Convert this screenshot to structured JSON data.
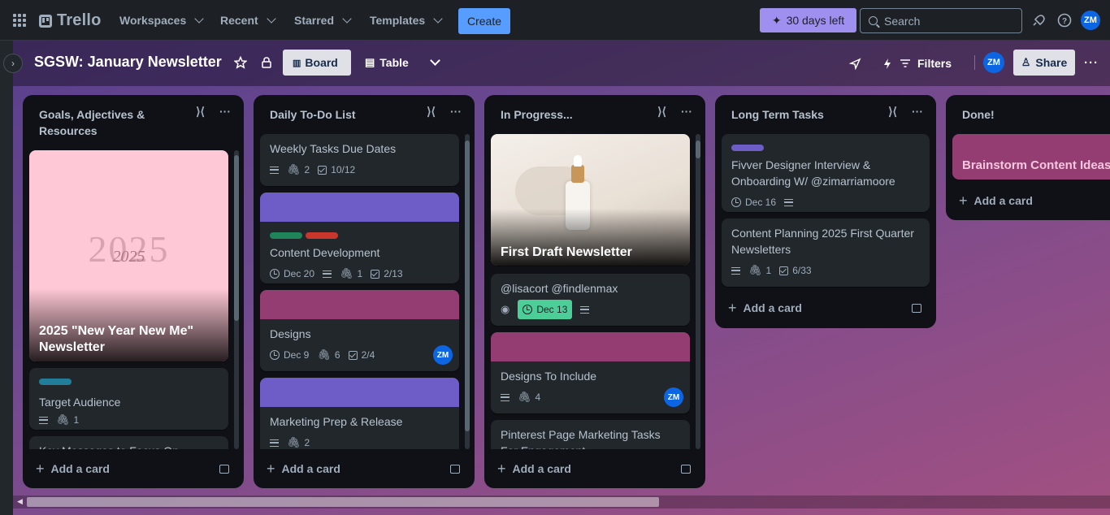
{
  "nav": {
    "logo": "Trello",
    "menus": [
      "Workspaces",
      "Recent",
      "Starred",
      "Templates"
    ],
    "create": "Create",
    "trial": "30 days left",
    "search_placeholder": "Search",
    "avatar": "ZM"
  },
  "board": {
    "title": "SGSW: January Newsletter",
    "views": {
      "board": "Board",
      "table": "Table"
    },
    "filters": "Filters",
    "member": "ZM",
    "share": "Share"
  },
  "lists": [
    {
      "title": "Goals, Adjectives & Resources",
      "add_card": "Add a card",
      "cards": [
        {
          "title": "2025 \"New Year New Me\" Newsletter",
          "cover_art_text": "2025"
        },
        {
          "title": "Target Audience",
          "label_color": "#227d9b",
          "attachments": "1"
        },
        {
          "title": "Key Messages to Focus On"
        }
      ]
    },
    {
      "title": "Daily To-Do List",
      "add_card": "Add a card",
      "cards": [
        {
          "title": "Weekly Tasks Due Dates",
          "attachments": "2",
          "checklist": "10/12"
        },
        {
          "title": "Content Development",
          "cover_color": "#6e5dc6",
          "labels": [
            "#1f845a",
            "#c9372c"
          ],
          "date": "Dec 20",
          "attachments": "1",
          "checklist": "2/13"
        },
        {
          "title": "Designs",
          "cover_color": "#943d73",
          "date": "Dec 9",
          "attachments": "6",
          "checklist": "2/4",
          "member": "ZM"
        },
        {
          "title": "Marketing Prep & Release",
          "cover_color": "#6e5dc6",
          "attachments": "2"
        }
      ]
    },
    {
      "title": "In Progress...",
      "add_card": "Add a card",
      "cards": [
        {
          "title": "First Draft Newsletter"
        },
        {
          "title": "@lisacort @findlenmax",
          "date": "Dec 13"
        },
        {
          "title": "Designs To Include",
          "cover_color": "#943d73",
          "attachments": "4",
          "member": "ZM"
        },
        {
          "title": "Pinterest Page Marketing Tasks For Engagement"
        }
      ]
    },
    {
      "title": "Long Term Tasks",
      "add_card": "Add a card",
      "cards": [
        {
          "title": "Fivver Designer Interview & Onboarding W/ @zimarriamoore",
          "label_color": "#6e5dc6",
          "date": "Dec 16"
        },
        {
          "title": "Content Planning 2025 First Quarter Newsletters",
          "attachments": "1",
          "checklist": "6/33"
        }
      ]
    },
    {
      "title": "Done!",
      "add_card": "Add a card",
      "cards": [
        {
          "title": "Brainstorm Content Ideas",
          "cover_color": "#943d73"
        }
      ]
    }
  ]
}
